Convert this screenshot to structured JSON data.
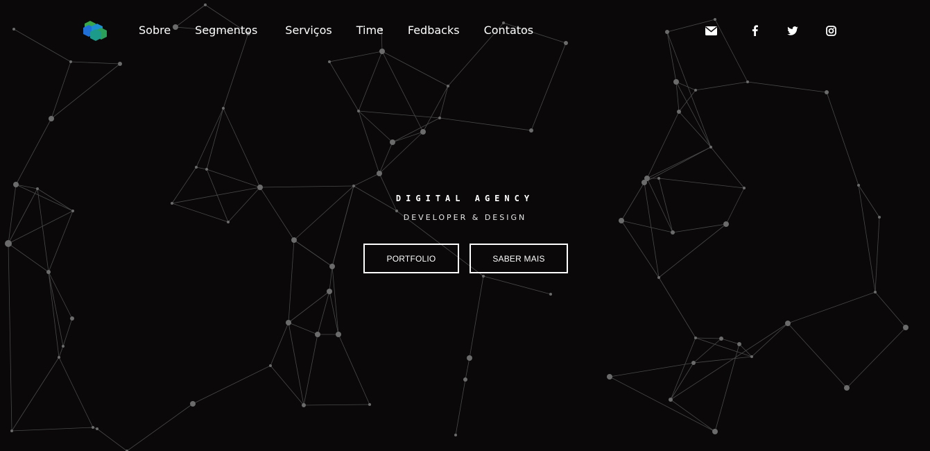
{
  "brand": {
    "logo_icon": "hexagon-cubes-logo",
    "colors": {
      "green": "#3aa84a",
      "blue": "#1f6fd6",
      "teal": "#1c9a8a"
    }
  },
  "nav": {
    "items": [
      {
        "label": "Sobre"
      },
      {
        "label": "Segmentos"
      },
      {
        "label": "Serviços"
      },
      {
        "label": "Time"
      },
      {
        "label": "Fedbacks"
      },
      {
        "label": "Contatos"
      }
    ]
  },
  "social": [
    {
      "icon": "envelope-icon"
    },
    {
      "icon": "facebook-icon"
    },
    {
      "icon": "twitter-icon"
    },
    {
      "icon": "instagram-icon"
    }
  ],
  "hero": {
    "tagline": "DIGITAL AGENCY",
    "subtitle": "DEVELOPER & DESIGN",
    "buttons": [
      {
        "label": "PORTFOLIO"
      },
      {
        "label": "SABER MAIS"
      }
    ]
  },
  "theme": {
    "background": "#0a0809",
    "node_color": "#6b6b6b",
    "line_color": "#4a4a4a",
    "text_color": "#ffffff"
  }
}
